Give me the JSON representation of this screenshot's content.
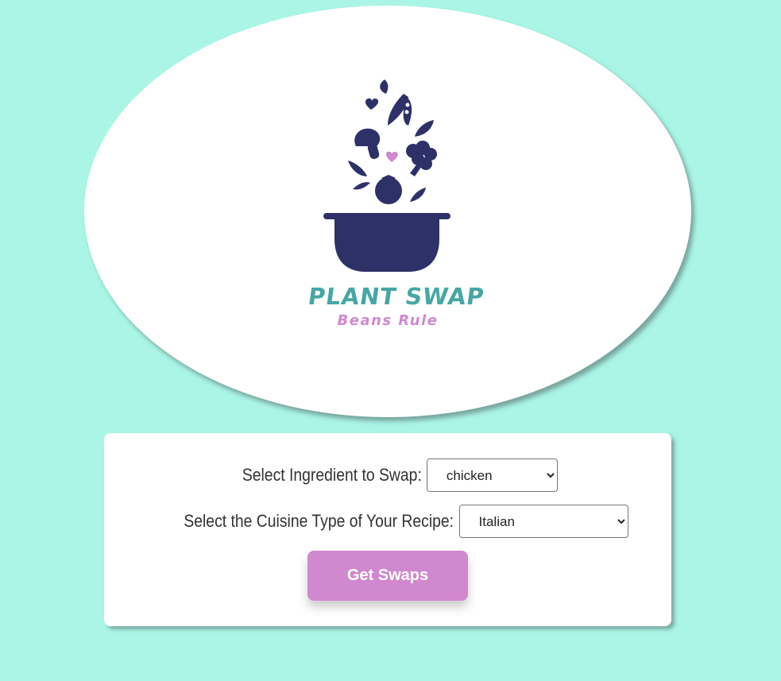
{
  "logo": {
    "title": "PLANT SWAP",
    "tagline": "Beans Rule",
    "icon": "pot-with-vegetables-icon"
  },
  "form": {
    "ingredient_label": "Select Ingredient to Swap:",
    "ingredient_value": "chicken",
    "cuisine_label": "Select the Cuisine Type of Your Recipe:",
    "cuisine_value": "Italian",
    "submit_label": "Get Swaps"
  },
  "colors": {
    "background": "#aaf5e6",
    "navy": "#2e3168",
    "teal": "#46a7a4",
    "pink": "#d088cf"
  }
}
